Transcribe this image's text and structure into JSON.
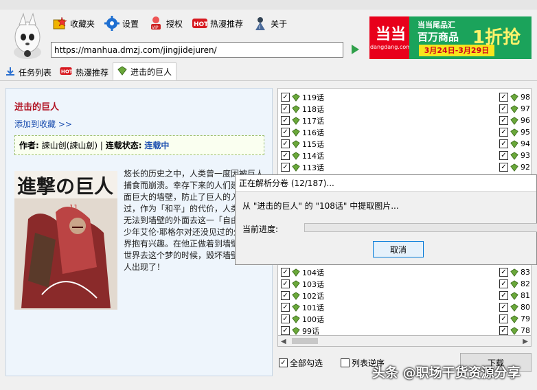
{
  "window": {
    "title": ""
  },
  "menu": [
    {
      "label": "收藏夹",
      "icon": "favorites-star-icon"
    },
    {
      "label": "设置",
      "icon": "gear-icon"
    },
    {
      "label": "授权",
      "icon": "vip-user-icon"
    },
    {
      "label": "热漫推荐",
      "icon": "hot-badge-icon"
    },
    {
      "label": "关于",
      "icon": "info-person-icon"
    }
  ],
  "url": "https://manhua.dmzj.com/jingjidejuren/",
  "ad": {
    "logo": "当当",
    "logo_sub": "dangdang.com",
    "line1": "当当尾品汇",
    "line2": "百万商品",
    "big": "1折抢",
    "dates": "3月24日-3月29日"
  },
  "tabs": [
    {
      "label": "任务列表",
      "icon": "download-icon"
    },
    {
      "label": "热漫推荐",
      "icon": "hot-badge-icon"
    },
    {
      "label": "进击的巨人",
      "icon": "green-book-icon",
      "active": true
    }
  ],
  "comic": {
    "title": "进击的巨人",
    "add_favorite": "添加到收藏 >>",
    "author_label": "作者:",
    "author": "諫山创(諫山創)",
    "separator": "|",
    "status_label": "连载状态:",
    "status": "连载中",
    "cover_title": "進撃の巨人",
    "cover_volume": "11",
    "description": "悠长的历史之中，人类曾一度因被巨人捕食而崩溃。幸存下来的人们建造了一面巨大的墙壁，防止了巨人的入侵。不过，作为「和平」的代价，人类便再也无法到墙壁的外面去这一「自由」……少年艾伦·耶格尔对还没见过的外面的世界抱有兴趣。在他正做着到墙壁外面的世界去这个梦的时候，毁坏墙壁的大巨人出现了！"
  },
  "chapters_left": [
    "119话",
    "118话",
    "117话",
    "116话",
    "115话",
    "114话",
    "113话",
    "",
    "",
    "",
    "",
    "",
    "",
    "",
    "",
    "104话",
    "103话",
    "102话",
    "101话",
    "100话",
    "99话"
  ],
  "chapters_right": [
    "98",
    "97",
    "96",
    "95",
    "94",
    "93",
    "92",
    "",
    "",
    "",
    "",
    "",
    "",
    "",
    "",
    "83",
    "82",
    "81",
    "80",
    "79",
    "78"
  ],
  "bottom": {
    "select_all": "全部勾选",
    "reverse": "列表逆序",
    "download": "下载"
  },
  "dialog": {
    "title": "正在解析分卷 (12/187)...",
    "message": "从 \"进击的巨人\" 的 \"108话\" 中提取图片...",
    "progress_label": "当前进度:",
    "progress": 0.0,
    "cancel": "取消"
  },
  "watermark": "头条 @职场干货资源分享"
}
